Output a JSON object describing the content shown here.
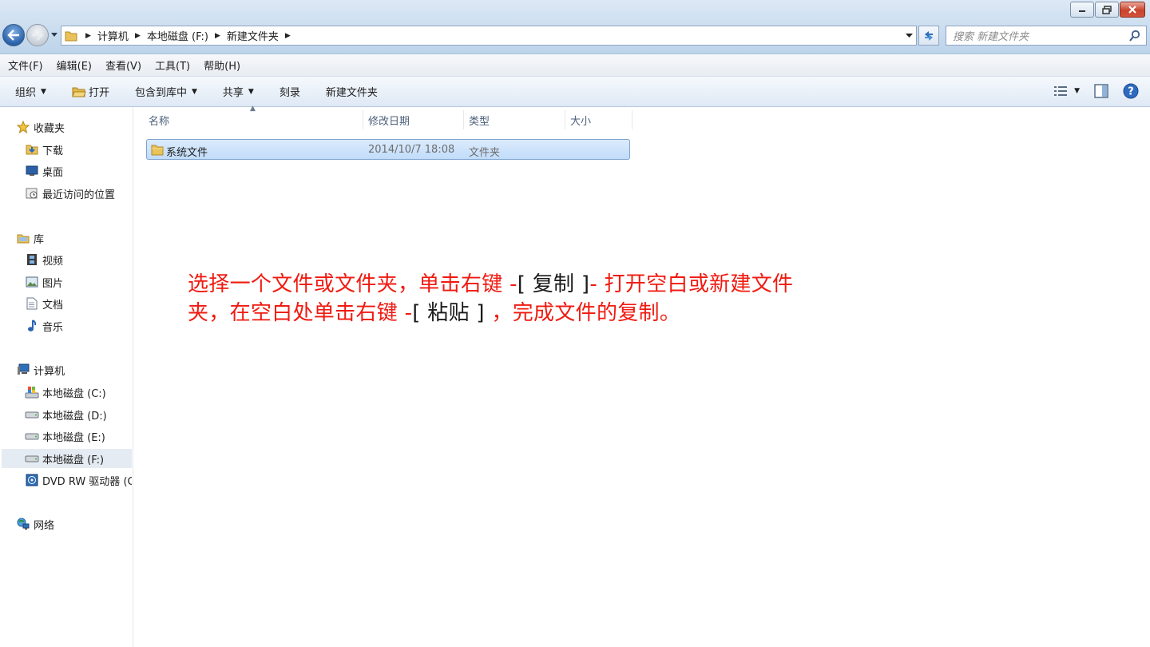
{
  "window": {
    "controls": [
      "minimize",
      "restore",
      "close"
    ]
  },
  "address": {
    "segments": [
      "计算机",
      "本地磁盘 (F:)",
      "新建文件夹"
    ]
  },
  "search": {
    "placeholder": "搜索 新建文件夹"
  },
  "menu": [
    "文件(F)",
    "编辑(E)",
    "查看(V)",
    "工具(T)",
    "帮助(H)"
  ],
  "commands": {
    "organize": "组织",
    "open": "打开",
    "include_library": "包含到库中",
    "share": "共享",
    "burn": "刻录",
    "new_folder": "新建文件夹"
  },
  "sidebar": {
    "favorites": {
      "label": "收藏夹",
      "items": [
        "下载",
        "桌面",
        "最近访问的位置"
      ]
    },
    "libraries": {
      "label": "库",
      "items": [
        "视频",
        "图片",
        "文档",
        "音乐"
      ]
    },
    "computer": {
      "label": "计算机",
      "items": [
        "本地磁盘 (C:)",
        "本地磁盘 (D:)",
        "本地磁盘 (E:)",
        "本地磁盘 (F:)",
        "DVD RW 驱动器 (G"
      ]
    },
    "network": {
      "label": "网络"
    },
    "selected": "本地磁盘 (F:)"
  },
  "columns": [
    "名称",
    "修改日期",
    "类型",
    "大小"
  ],
  "files": [
    {
      "name": "系统文件",
      "modified": "2014/10/7 18:08",
      "type": "文件夹",
      "size": ""
    }
  ],
  "annotation": {
    "line1_red_a": "选择一个文件或文件夹，单击右键 -",
    "line1_blk": "[ 复制 ]",
    "line1_red_b": "- 打开空白或新建文件",
    "line2_red_a": "夹，在空白处单击右键 -",
    "line2_blk": "[ 粘贴 ]",
    "line2_red_b": " ，完成文件的复制。"
  },
  "colors": {
    "annotation_red": "#f01a10",
    "selection_blue": "#c1dcfa",
    "chrome_blue": "#c9dcef"
  }
}
